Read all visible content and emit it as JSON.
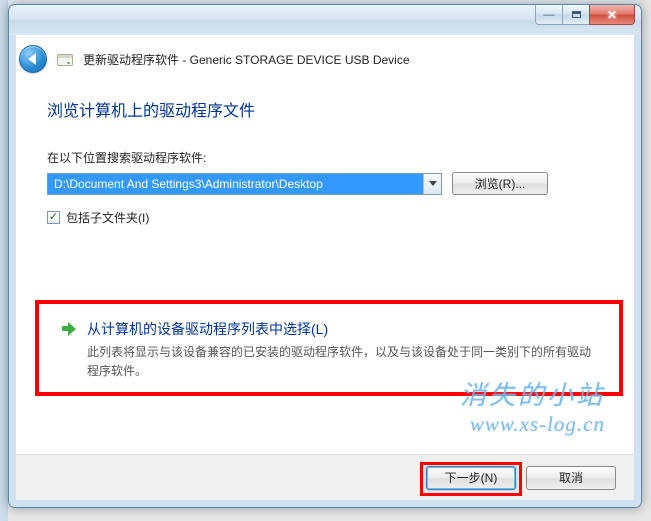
{
  "wizard": {
    "title_prefix": "更新驱动程序软件 - ",
    "device_name": "Generic STORAGE DEVICE USB Device"
  },
  "heading": "浏览计算机上的驱动程序文件",
  "search": {
    "label": "在以下位置搜索驱动程序软件:",
    "path": "D:\\Document And Settings3\\Administrator\\Desktop",
    "browse_button": "浏览(R)..."
  },
  "include_subfolders": {
    "checked": true,
    "label": "包括子文件夹(I)"
  },
  "pick_from_list": {
    "title": "从计算机的设备驱动程序列表中选择(L)",
    "description": "此列表将显示与该设备兼容的已安装的驱动程序软件，以及与该设备处于同一类别下的所有驱动程序软件。"
  },
  "footer": {
    "next": "下一步(N)",
    "cancel": "取消"
  },
  "watermark": {
    "line1": "消失的小站",
    "line2": "www.xs-log.cn"
  },
  "icons": {
    "back": "back-arrow-icon",
    "drive": "drive-icon",
    "dropdown": "chevron-down-icon",
    "go": "go-arrow-icon",
    "minimize": "minimize-icon",
    "maximize": "maximize-icon",
    "close": "close-icon",
    "check": "check-icon"
  }
}
